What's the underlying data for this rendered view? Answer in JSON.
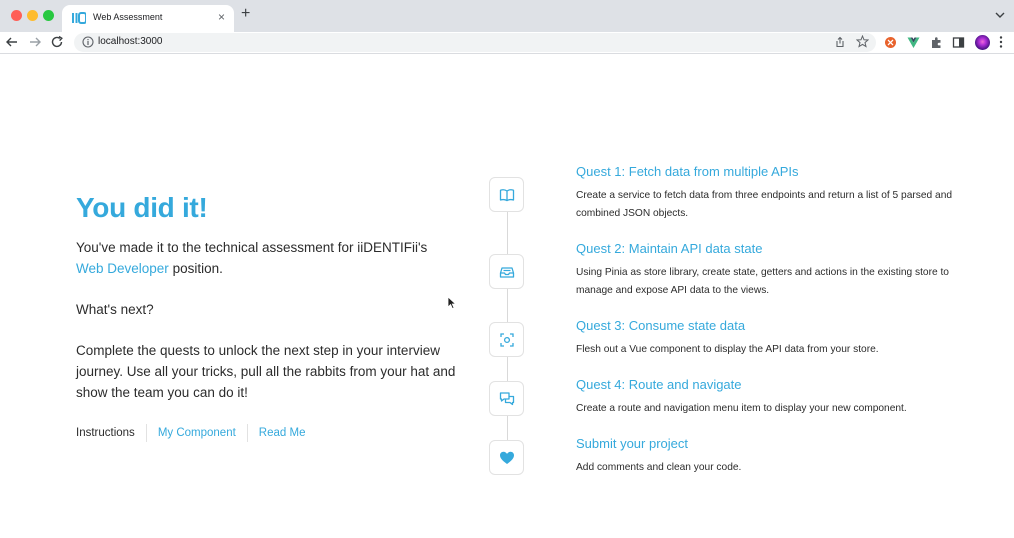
{
  "browser": {
    "tab_title": "Web Assessment",
    "tab_close": "×",
    "new_tab": "+",
    "url": "localhost:3000"
  },
  "page": {
    "title": "You did it!",
    "intro_before": "You've made it to the technical assessment for iiDENTIFii's",
    "intro_link": "Web Developer",
    "intro_after": " position.",
    "whats_next": "What's next?",
    "instructions": "Complete the quests to unlock the next step in your interview journey. Use all your tricks, pull all the rabbits from your hat and show the team you can do it!",
    "nav": {
      "instructions": "Instructions",
      "my_component": "My Component",
      "read_me": "Read Me"
    }
  },
  "quests": [
    {
      "title": "Quest 1: Fetch data from multiple APIs",
      "description": "Create a service to fetch data from three endpoints and return a list of 5 parsed and combined JSON objects.",
      "icon": "book-icon"
    },
    {
      "title": "Quest 2: Maintain API data state",
      "description": "Using Pinia as store library, create state, getters and actions in the existing store to manage and expose API data to the views.",
      "icon": "archive-icon"
    },
    {
      "title": "Quest 3: Consume state data",
      "description": "Flesh out a Vue component to display the API data from your store.",
      "icon": "focus-icon"
    },
    {
      "title": "Quest 4: Route and navigate",
      "description": "Create a route and navigation menu item to display your new component.",
      "icon": "chat-icon"
    },
    {
      "title": "Submit your project",
      "description": "Add comments and clean your code.",
      "icon": "heart-icon"
    }
  ],
  "colors": {
    "accent": "#35a9dc",
    "text": "#2c2c2c"
  }
}
